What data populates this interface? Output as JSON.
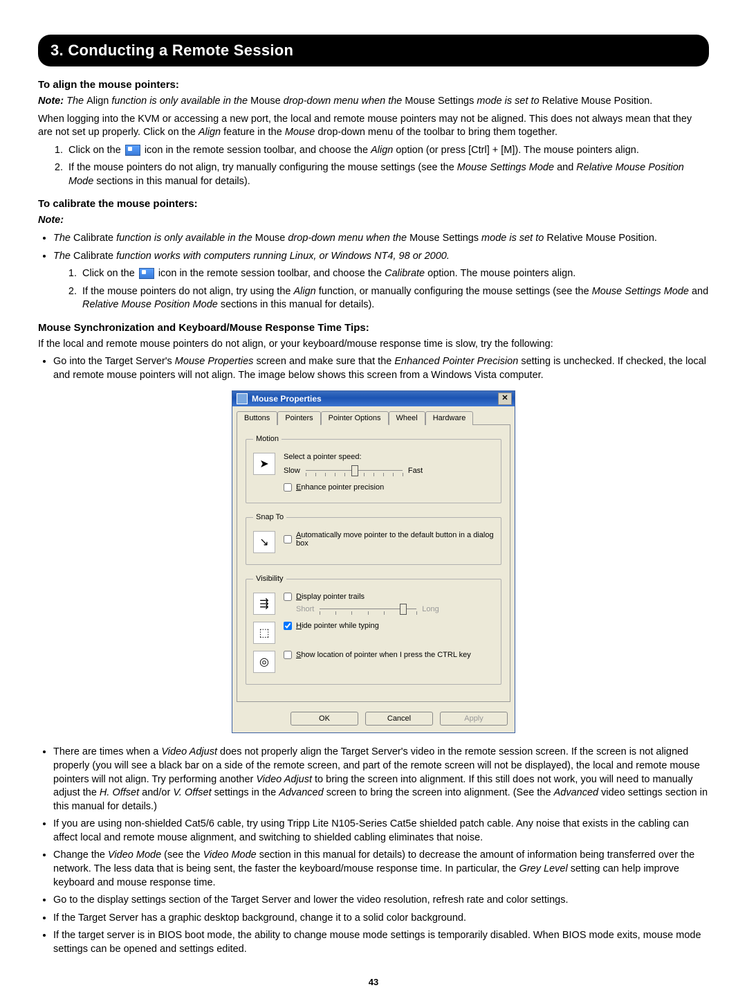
{
  "banner": "3. Conducting a Remote Session",
  "align": {
    "heading": "To align the mouse pointers:",
    "note_label": "Note:",
    "note_pre": " The ",
    "note_align": "Align",
    "note_mid1": " function is only available in the ",
    "note_mouse": "Mouse",
    "note_mid2": " drop-down menu when the ",
    "note_ms": "Mouse Settings",
    "note_mid3": " mode is set to ",
    "note_rmp": "Relative Mouse Position.",
    "p1_a": "When logging into the KVM or accessing a new port, the local and remote mouse pointers may not be aligned. This does not always mean that they are not set up properly. Click on the ",
    "p1_align": "Align",
    "p1_b": " feature in the ",
    "p1_mouse": "Mouse",
    "p1_c": " drop-down menu of the toolbar to bring them together.",
    "li1_a": "Click on the ",
    "li1_b": " icon in the remote session toolbar, and choose the ",
    "li1_align": "Align",
    "li1_c": " option (or press [Ctrl] + [M]). The mouse pointers align.",
    "li2_a": "If the mouse pointers do not align, try manually configuring the mouse settings (see the ",
    "li2_msm": "Mouse Settings Mode",
    "li2_b": " and ",
    "li2_rmpm": "Relative Mouse Position Mode",
    "li2_c": " sections in this manual for details)."
  },
  "calibrate": {
    "heading": "To calibrate the mouse pointers:",
    "note_label": "Note:",
    "b1_a": "The ",
    "b1_cal": "Calibrate",
    "b1_b": " function is only available in the ",
    "b1_mouse": "Mouse",
    "b1_c": " drop-down menu when the ",
    "b1_ms": "Mouse Settings",
    "b1_d": " mode is set to ",
    "b1_rmp": "Relative Mouse Position.",
    "b2_a": "The ",
    "b2_cal": "Calibrate",
    "b2_b": " function works with computers running Linux, or Windows NT4, 98 or 2000.",
    "li1_a": "Click on the ",
    "li1_b": " icon in the remote session toolbar, and choose the ",
    "li1_cal": "Calibrate",
    "li1_c": " option. The mouse pointers align.",
    "li2_a": "If the mouse pointers do not align, try using the ",
    "li2_align": "Align",
    "li2_b": " function, or manually configuring the mouse settings (see the ",
    "li2_msm": "Mouse Settings Mode",
    "li2_c": " and ",
    "li2_rmpm": "Relative Mouse Position Mode",
    "li2_d": " sections in this manual for details)."
  },
  "tips": {
    "heading": "Mouse Synchronization and Keyboard/Mouse Response Time Tips:",
    "intro": "If the local and remote mouse pointers do not align, or your keyboard/mouse response time is slow, try the following:",
    "b1_a": "Go into the Target Server's ",
    "b1_mp": "Mouse Properties",
    "b1_b": " screen and make sure that the ",
    "b1_epp": "Enhanced Pointer Precision",
    "b1_c": " setting is unchecked. If checked, the local and remote mouse pointers will not align. The image below shows this screen from a Windows Vista computer.",
    "b2_a": "There are times when a ",
    "b2_va": "Video Adjust",
    "b2_b": " does not properly align the Target Server's video in the remote session screen. If the screen is not aligned properly (you will see a black bar on a side of the remote screen, and part of the remote screen will not be displayed), the local and remote mouse pointers will not align. Try performing another ",
    "b2_va2": "Video Adjust",
    "b2_c": " to bring the screen into alignment. If this still does not work, you will need to manually adjust the ",
    "b2_ho": "H. Offset",
    "b2_d": " and/or ",
    "b2_vo": "V. Offset",
    "b2_e": " settings in the ",
    "b2_adv": "Advanced",
    "b2_f": " screen to bring the screen into alignment. (See the ",
    "b2_adv2": "Advanced",
    "b2_g": " video settings section in this manual for details.)",
    "b3": "If you are using non-shielded Cat5/6 cable, try using Tripp Lite N105-Series Cat5e shielded patch cable. Any noise that exists in the cabling can affect local and remote mouse alignment, and switching to shielded cabling eliminates that noise.",
    "b4_a": "Change the ",
    "b4_vm": "Video Mode",
    "b4_b": " (see the ",
    "b4_vm2": "Video Mode",
    "b4_c": " section in this manual for details) to decrease the amount of information being transferred over the network. The less data that is being sent, the faster the keyboard/mouse response time. In particular, the ",
    "b4_gl": "Grey Level",
    "b4_d": " setting can help improve keyboard and mouse response time.",
    "b5": "Go to the display settings section of the Target Server and lower the video resolution, refresh rate and color settings.",
    "b6": "If the Target Server has a graphic desktop background, change it to a solid color background.",
    "b7": "If the target server is in BIOS boot mode, the ability to change mouse mode settings is temporarily disabled. When BIOS mode exits, mouse mode settings can be opened and settings edited."
  },
  "dialog": {
    "title": "Mouse Properties",
    "tabs": [
      "Buttons",
      "Pointers",
      "Pointer Options",
      "Wheel",
      "Hardware"
    ],
    "active_tab": 2,
    "motion": {
      "legend": "Motion",
      "label": "Select a pointer speed:",
      "slow": "Slow",
      "fast": "Fast",
      "enhance": "Enhance pointer precision"
    },
    "snap": {
      "legend": "Snap To",
      "label": "Automatically move pointer to the default button in a dialog box"
    },
    "visibility": {
      "legend": "Visibility",
      "trails": "Display pointer trails",
      "short": "Short",
      "long": "Long",
      "hide": "Hide pointer while typing",
      "ctrl": "Show location of pointer when I press the CTRL key"
    },
    "buttons": {
      "ok": "OK",
      "cancel": "Cancel",
      "apply": "Apply"
    }
  },
  "page_number": "43"
}
